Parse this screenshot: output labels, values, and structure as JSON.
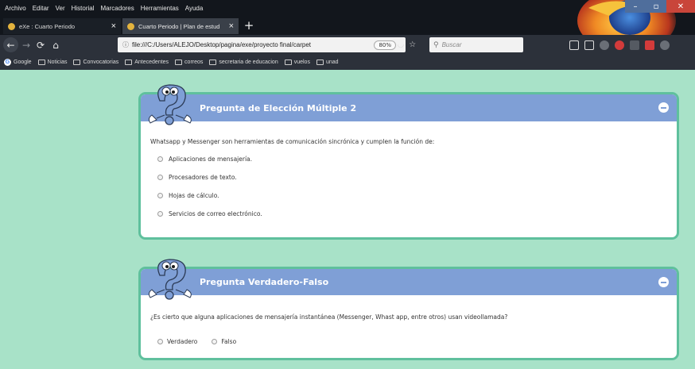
{
  "window": {
    "menu": [
      "Archivo",
      "Editar",
      "Ver",
      "Historial",
      "Marcadores",
      "Herramientas",
      "Ayuda"
    ]
  },
  "tabs": [
    {
      "label": "eXe : Cuarto Periodo",
      "active": false
    },
    {
      "label": "Cuarto Periodo | Plan de estud",
      "active": true
    }
  ],
  "navbar": {
    "url": "file:///C:/Users/ALEJO/Desktop/pagina/exe/proyecto final/carpet",
    "zoom": "80%",
    "search_placeholder": "Buscar"
  },
  "bookmarks": [
    "Google",
    "Noticias",
    "Convocatorias",
    "Antecedentes",
    "correos",
    "secretaria de educacion",
    "vuelos",
    "unad"
  ],
  "colors": {
    "page_bg": "#a8e2c8",
    "card_border": "#5fc09d",
    "card_header": "#7f9fd6"
  },
  "questions": [
    {
      "title": "Pregunta de Elección Múltiple 2",
      "prompt": "Whatsapp y Messenger son herramientas de comunicación sincrónica y cumplen la función de:",
      "options": [
        "Aplicaciones de mensajería.",
        "Procesadores de texto.",
        "Hojas de cálculo.",
        "Servicios de correo electrónico."
      ]
    },
    {
      "title": "Pregunta Verdadero-Falso",
      "prompt": "¿Es cierto que alguna aplicaciones de mensajería instantánea (Messenger, Whast app, entre otros) usan videollamada?",
      "options": [
        "Verdadero",
        "Falso"
      ]
    }
  ]
}
